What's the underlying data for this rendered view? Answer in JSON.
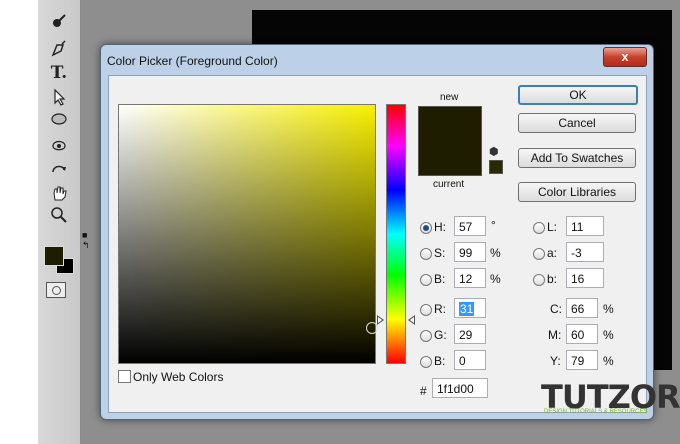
{
  "dialog": {
    "title": "Color Picker (Foreground Color)",
    "close_label": "x",
    "new_label": "new",
    "current_label": "current",
    "only_web_colors_label": "Only Web Colors",
    "buttons": {
      "ok": "OK",
      "cancel": "Cancel",
      "add_to_swatches": "Add To Swatches",
      "color_libraries": "Color Libraries"
    },
    "hsb": {
      "h": {
        "label": "H:",
        "value": "57",
        "unit": "°"
      },
      "s": {
        "label": "S:",
        "value": "99",
        "unit": "%"
      },
      "b": {
        "label": "B:",
        "value": "12",
        "unit": "%"
      }
    },
    "rgb": {
      "r": {
        "label": "R:",
        "value": "31"
      },
      "g": {
        "label": "G:",
        "value": "29"
      },
      "b": {
        "label": "B:",
        "value": "0"
      }
    },
    "lab": {
      "l": {
        "label": "L:",
        "value": "11"
      },
      "a": {
        "label": "a:",
        "value": "-3"
      },
      "b": {
        "label": "b:",
        "value": "16"
      }
    },
    "cmyk": {
      "c": {
        "label": "C:",
        "value": "66",
        "unit": "%"
      },
      "m": {
        "label": "M:",
        "value": "60",
        "unit": "%"
      },
      "y": {
        "label": "Y:",
        "value": "79",
        "unit": "%"
      }
    },
    "hex": {
      "label": "#",
      "value": "1f1d00"
    },
    "selected_radio": "H",
    "colors": {
      "new_color": "#1f1d00",
      "current_color": "#1f1d00",
      "hue_color": "#f8f000"
    }
  },
  "watermark": {
    "logo": "TUTZOR",
    "tagline": "DESIGN TUTORIALS & RESOURCES"
  },
  "toolbar": {
    "tools": [
      "brush-icon",
      "pen-icon",
      "type-icon",
      "path-select-icon",
      "ellipse-icon",
      "hand-drag-icon",
      "rotate-icon",
      "hand-icon",
      "zoom-icon"
    ]
  }
}
